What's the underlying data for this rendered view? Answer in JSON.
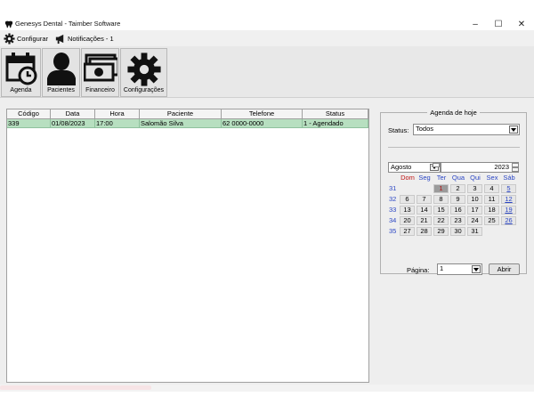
{
  "window": {
    "title": "Genesys Dental - Taimber Software",
    "minimize": "–",
    "maximize": "☐",
    "close": "✕"
  },
  "menu": {
    "configurar": "Configurar",
    "notificacoes": "Notificações - 1"
  },
  "toolbar": {
    "agenda": "Agenda",
    "pacientes": "Pacientes",
    "financeiro": "Financeiro",
    "configuracoes": "Configurações"
  },
  "grid": {
    "columns": [
      "Código",
      "Data",
      "Hora",
      "Paciente",
      "Telefone",
      "Status"
    ],
    "rows": [
      [
        "339",
        "01/08/2023",
        "17:00",
        "Salomão Silva",
        "62 0000-0000",
        "1 - Agendado"
      ]
    ]
  },
  "panel": {
    "title": "Agenda de hoje",
    "status_label": "Status:",
    "status_value": "Todos",
    "calendar": {
      "month": "Agosto",
      "year": "2023",
      "weekdays": [
        "Dom",
        "Seg",
        "Ter",
        "Qua",
        "Qui",
        "Sex",
        "Sáb"
      ],
      "weeks": [
        "31",
        "32",
        "33",
        "34",
        "35"
      ],
      "days": [
        [
          "",
          "",
          "1",
          "2",
          "3",
          "4",
          "5"
        ],
        [
          "6",
          "7",
          "8",
          "9",
          "10",
          "11",
          "12"
        ],
        [
          "13",
          "14",
          "15",
          "16",
          "17",
          "18",
          "19"
        ],
        [
          "20",
          "21",
          "22",
          "23",
          "24",
          "25",
          "26"
        ],
        [
          "27",
          "28",
          "29",
          "30",
          "31",
          "",
          ""
        ]
      ],
      "selected_day": "1"
    },
    "page_label": "Página:",
    "page_value": "1",
    "open_button": "Abrir"
  }
}
